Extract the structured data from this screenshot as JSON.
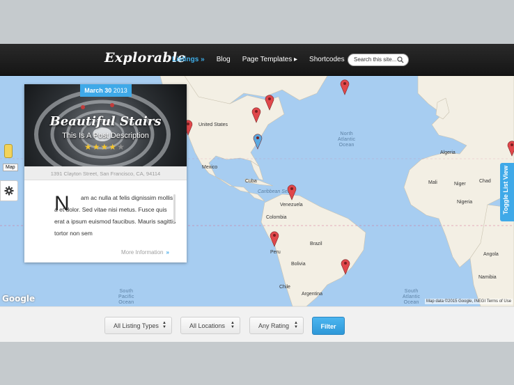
{
  "header": {
    "logo": "Explorable",
    "nav": [
      {
        "label": "Listings »",
        "active": true
      },
      {
        "label": "Blog",
        "active": false
      },
      {
        "label": "Page Templates ▸",
        "active": false
      },
      {
        "label": "Shortcodes",
        "active": false
      }
    ],
    "search_placeholder": "Search this site..."
  },
  "map": {
    "ocean_labels": {
      "north_atlantic": "North\nAtlantic\nOcean",
      "south_pacific": "South\nPacific\nOcean",
      "south_atlantic": "South\nAtlantic\nOcean"
    },
    "places": {
      "united_states": "United States",
      "mexico": "Mexico",
      "cuba": "Cuba",
      "caribbean_sea": "Caribbean Sea",
      "venezuela": "Venezuela",
      "colombia": "Colombia",
      "peru": "Peru",
      "brazil": "Brazil",
      "bolivia": "Bolivia",
      "chile": "Chile",
      "argentina": "Argentina",
      "mali": "Mali",
      "niger": "Niger",
      "chad": "Chad",
      "nigeria": "Nigeria",
      "angola": "Angola",
      "namibia": "Namibia",
      "algeria": "Algeria"
    },
    "google_logo": "Google",
    "attribution": "Map data ©2015 Google, INEGI   Terms of Use",
    "map_type": "Map",
    "toggle_list_view": "Toggle List View"
  },
  "card": {
    "date_month_day": "March 30",
    "date_year": "2013",
    "title": "Beautiful Stairs",
    "description": "This Is A Post Description",
    "rating": 4,
    "rating_max": 5,
    "address": "1391 Clayton Street, San Francisco, CA, 94114",
    "dropcap": "N",
    "excerpt": "am ac nulla at felis dignissim mollis a et dolor. Sed vitae nisi metus. Fusce quis erat a ipsum euismod faucibus. Mauris sagittis tortor non sem",
    "more_info": "More Information",
    "more_info_arrow": "»"
  },
  "filters": {
    "listing_types": "All Listing Types",
    "locations": "All Locations",
    "rating": "Any Rating",
    "button": "Filter"
  },
  "colors": {
    "accent": "#3fa9e8",
    "header_bg": "#1c1c1c",
    "ocean": "#a7cdf1",
    "land": "#f3efe4",
    "pin_red": "#e0474b",
    "pin_blue": "#5aa9e0"
  }
}
